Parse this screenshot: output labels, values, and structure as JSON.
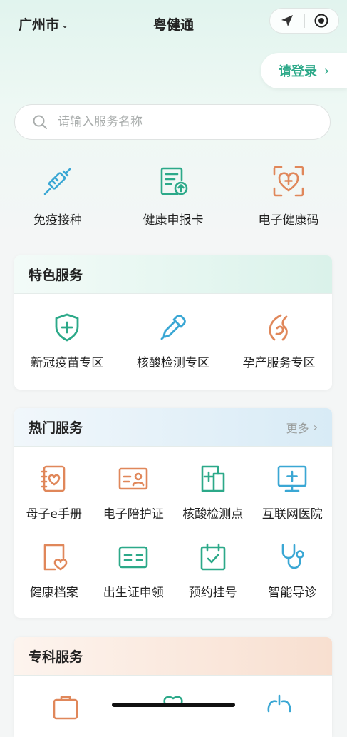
{
  "header": {
    "city": "广州市",
    "title": "粤健通"
  },
  "login": {
    "label": "请登录"
  },
  "search": {
    "placeholder": "请输入服务名称"
  },
  "quick": [
    {
      "label": "免疫接种",
      "icon": "syringe-icon"
    },
    {
      "label": "健康申报卡",
      "icon": "upload-document-icon"
    },
    {
      "label": "电子健康码",
      "icon": "heart-scan-icon"
    }
  ],
  "featured": {
    "title": "特色服务",
    "items": [
      {
        "label": "新冠疫苗专区",
        "icon": "shield-plus-icon"
      },
      {
        "label": "核酸检测专区",
        "icon": "dropper-icon"
      },
      {
        "label": "孕产服务专区",
        "icon": "pregnancy-icon"
      }
    ]
  },
  "hot": {
    "title": "热门服务",
    "more": "更多",
    "items": [
      {
        "label": "母子e手册",
        "icon": "handbook-icon"
      },
      {
        "label": "电子陪护证",
        "icon": "id-card-icon"
      },
      {
        "label": "核酸检测点",
        "icon": "test-site-icon"
      },
      {
        "label": "互联网医院",
        "icon": "monitor-plus-icon"
      },
      {
        "label": "健康档案",
        "icon": "health-record-icon"
      },
      {
        "label": "出生证申领",
        "icon": "birth-certificate-icon"
      },
      {
        "label": "预约挂号",
        "icon": "calendar-check-icon"
      },
      {
        "label": "智能导诊",
        "icon": "stethoscope-icon"
      }
    ]
  },
  "special": {
    "title": "专科服务"
  },
  "colors": {
    "brand_green": "#2ca989",
    "icon_blue": "#3aa7d4",
    "icon_orange": "#e0875a"
  }
}
